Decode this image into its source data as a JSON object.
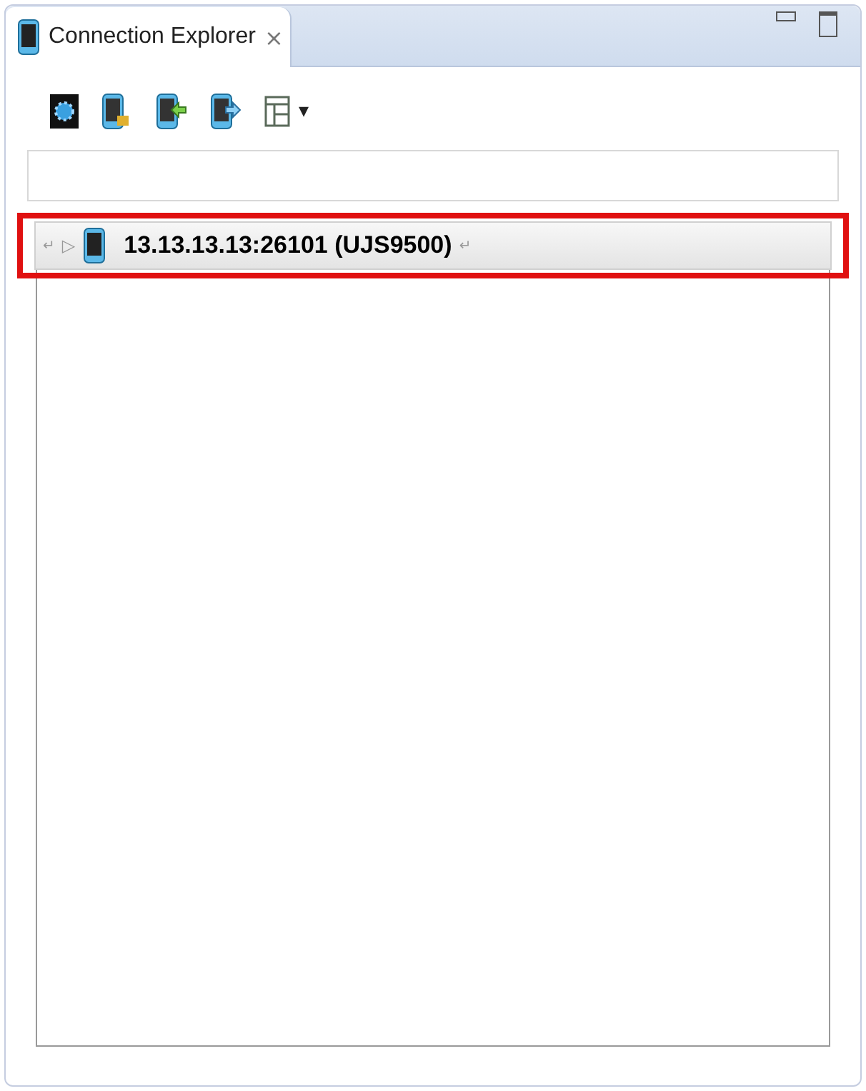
{
  "view_tab": {
    "title": "Connection Explorer",
    "close": "⨯"
  },
  "toolbar": [
    {
      "kind": "gear"
    },
    {
      "kind": "plug"
    },
    {
      "kind": "import"
    },
    {
      "kind": "export"
    },
    {
      "kind": "layout",
      "menu": "▾"
    }
  ],
  "tree": [
    {
      "label": "13.13.13.13:26101 (UJS9500)",
      "expander": "▷",
      "mark_before": "↵",
      "mark_after": "↵",
      "selected": true,
      "expanded": false,
      "highlighted": true
    }
  ]
}
